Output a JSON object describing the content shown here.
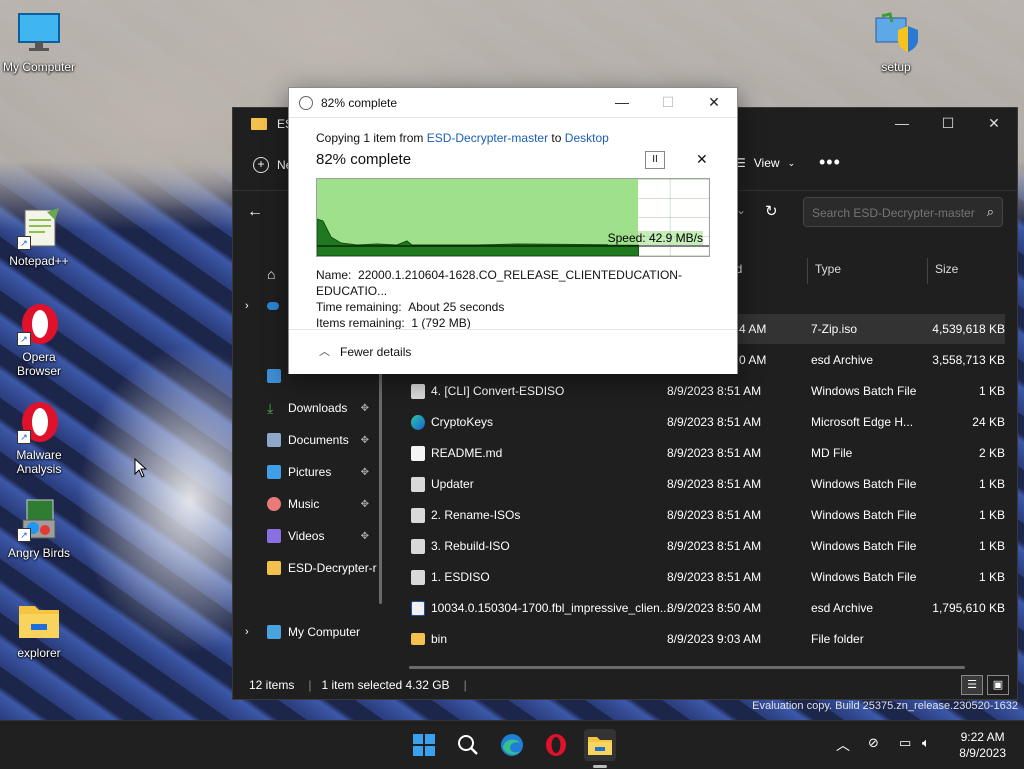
{
  "desktop": {
    "icons": [
      {
        "label": "My Computer",
        "icon": "monitor-icon"
      },
      {
        "label": "Notepad++",
        "icon": "notepad-plus-plus-icon"
      },
      {
        "label": "Opera Browser",
        "icon": "opera-icon"
      },
      {
        "label": "Malware Analysis",
        "icon": "opera-icon"
      },
      {
        "label": "Angry Birds",
        "icon": "installer-icon"
      },
      {
        "label": "explorer",
        "icon": "folder-icon"
      },
      {
        "label": "setup",
        "icon": "setup-shield-icon"
      }
    ],
    "watermark": "Evaluation copy. Build 25375.zn_release.230520-1632"
  },
  "explorer": {
    "title": "ES",
    "toolbar": {
      "new_label": "Ne",
      "view_label": "View",
      "more": "•••"
    },
    "search_placeholder": "Search ESD-Decrypter-master",
    "nav": {
      "items": [
        {
          "label": "Downloads",
          "icon": "download-icon",
          "color": "#4caf50",
          "pinned": true
        },
        {
          "label": "Documents",
          "icon": "document-icon",
          "color": "#8fa8c8",
          "pinned": true
        },
        {
          "label": "Pictures",
          "icon": "pictures-icon",
          "color": "#3fa0e8",
          "pinned": true
        },
        {
          "label": "Music",
          "icon": "music-icon",
          "color": "#e87a7a",
          "pinned": true
        },
        {
          "label": "Videos",
          "icon": "videos-icon",
          "color": "#8a6fe0",
          "pinned": true
        },
        {
          "label": "ESD-Decrypter-r",
          "icon": "folder-icon",
          "color": "#f2c14e",
          "pinned": false
        },
        {
          "label": "My Computer",
          "icon": "monitor-icon",
          "color": "#4aa3df",
          "pinned": false
        }
      ],
      "pin_glyph": "📌"
    },
    "columns": {
      "date_fragment": "ed",
      "type": "Type",
      "size": "Size"
    },
    "files": [
      {
        "name": "",
        "date": "4 AM",
        "type": "7-Zip.iso",
        "size": "4,539,618 KB",
        "icon": "iso-icon",
        "selected": true
      },
      {
        "name": "",
        "date": "0 AM",
        "type": "esd Archive",
        "size": "3,558,713 KB",
        "icon": "archive-icon",
        "selected": false
      },
      {
        "name": "4. [CLI] Convert-ESDISO",
        "date": "8/9/2023 8:51 AM",
        "type": "Windows Batch File",
        "size": "1 KB",
        "icon": "batch-file-icon",
        "selected": false
      },
      {
        "name": "CryptoKeys",
        "date": "8/9/2023 8:51 AM",
        "type": "Microsoft Edge H...",
        "size": "24 KB",
        "icon": "edge-icon",
        "selected": false
      },
      {
        "name": "README.md",
        "date": "8/9/2023 8:51 AM",
        "type": "MD File",
        "size": "2 KB",
        "icon": "file-icon",
        "selected": false
      },
      {
        "name": "Updater",
        "date": "8/9/2023 8:51 AM",
        "type": "Windows Batch File",
        "size": "1 KB",
        "icon": "batch-file-icon",
        "selected": false
      },
      {
        "name": "2. Rename-ISOs",
        "date": "8/9/2023 8:51 AM",
        "type": "Windows Batch File",
        "size": "1 KB",
        "icon": "batch-file-icon",
        "selected": false
      },
      {
        "name": "3. Rebuild-ISO",
        "date": "8/9/2023 8:51 AM",
        "type": "Windows Batch File",
        "size": "1 KB",
        "icon": "batch-file-icon",
        "selected": false
      },
      {
        "name": "1. ESDISO",
        "date": "8/9/2023 8:51 AM",
        "type": "Windows Batch File",
        "size": "1 KB",
        "icon": "batch-file-icon",
        "selected": false
      },
      {
        "name": "10034.0.150304-1700.fbl_impressive_clien...",
        "date": "8/9/2023 8:50 AM",
        "type": "esd Archive",
        "size": "1,795,610 KB",
        "icon": "archive-icon",
        "selected": false
      },
      {
        "name": "bin",
        "date": "8/9/2023 9:03 AM",
        "type": "File folder",
        "size": "",
        "icon": "folder-icon",
        "selected": false
      }
    ],
    "status": {
      "count": "12 items",
      "selected": "1 item selected  4.32 GB",
      "sep": "|"
    }
  },
  "dialog": {
    "title": "82% complete",
    "copying_prefix": "Copying 1 item from",
    "source": "ESD-Decrypter-master",
    "to_word": "to",
    "destination": "Desktop",
    "status": "82% complete",
    "progress": 0.82,
    "speed": "Speed: 42.9 MB/s",
    "name_label": "Name:",
    "name_value": "22000.1.210604-1628.CO_RELEASE_CLIENTEDUCATION-EDUCATIO...",
    "time_label": "Time remaining:",
    "time_value": "About 25 seconds",
    "items_label": "Items remaining:",
    "items_value": "1 (792 MB)",
    "fewer_details": "Fewer details",
    "pause_glyph": "II",
    "close_glyph": "✕",
    "colors": {
      "graph_fill": "#9fe08a",
      "graph_line": "#1f8f1f",
      "link": "#1a5fb4"
    }
  },
  "taskbar": {
    "apps": [
      {
        "icon": "windows-start-icon"
      },
      {
        "icon": "search-icon"
      },
      {
        "icon": "edge-icon"
      },
      {
        "icon": "opera-icon"
      },
      {
        "icon": "file-explorer-icon",
        "active": true
      }
    ],
    "time": "9:22 AM",
    "date": "8/9/2023"
  }
}
